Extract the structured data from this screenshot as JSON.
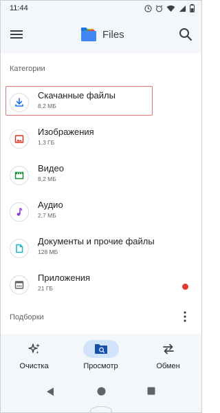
{
  "status_bar": {
    "time": "11:44",
    "icons": [
      "focus-mode-icon",
      "alarm-icon",
      "wifi-icon",
      "signal-icon",
      "battery-icon"
    ]
  },
  "app_bar": {
    "title": "Files",
    "menu_icon": "menu-icon",
    "search_icon": "search-icon",
    "logo": "files-logo"
  },
  "categories": {
    "title": "Категории",
    "items": [
      {
        "name": "Скачанные файлы",
        "size": "8,2 МБ",
        "icon": "download-icon",
        "color": "#1a73e8"
      },
      {
        "name": "Изображения",
        "size": "1,3 ГБ",
        "icon": "image-icon",
        "color": "#d93025"
      },
      {
        "name": "Видео",
        "size": "8,2 МБ",
        "icon": "video-icon",
        "color": "#1e8e3e"
      },
      {
        "name": "Аудио",
        "size": "2,7 МБ",
        "icon": "music-note-icon",
        "color": "#9334e6"
      },
      {
        "name": "Документы и прочие файлы",
        "size": "128 МБ",
        "icon": "document-icon",
        "color": "#12b5cb"
      },
      {
        "name": "Приложения",
        "size": "21 ГБ",
        "icon": "apps-icon",
        "color": "#5f6368",
        "badge_color": "#e53935"
      }
    ]
  },
  "collections": {
    "title": "Подборки",
    "more_icon": "more-vert-icon"
  },
  "bottom_nav": {
    "active": "Просмотр",
    "items": [
      {
        "label": "Очистка",
        "icon": "sparkle-icon"
      },
      {
        "label": "Просмотр",
        "icon": "browse-folder-icon"
      },
      {
        "label": "Обмен",
        "icon": "swap-icon"
      }
    ]
  },
  "system_nav": {
    "icons": [
      "back-icon",
      "home-icon",
      "recents-icon"
    ]
  }
}
